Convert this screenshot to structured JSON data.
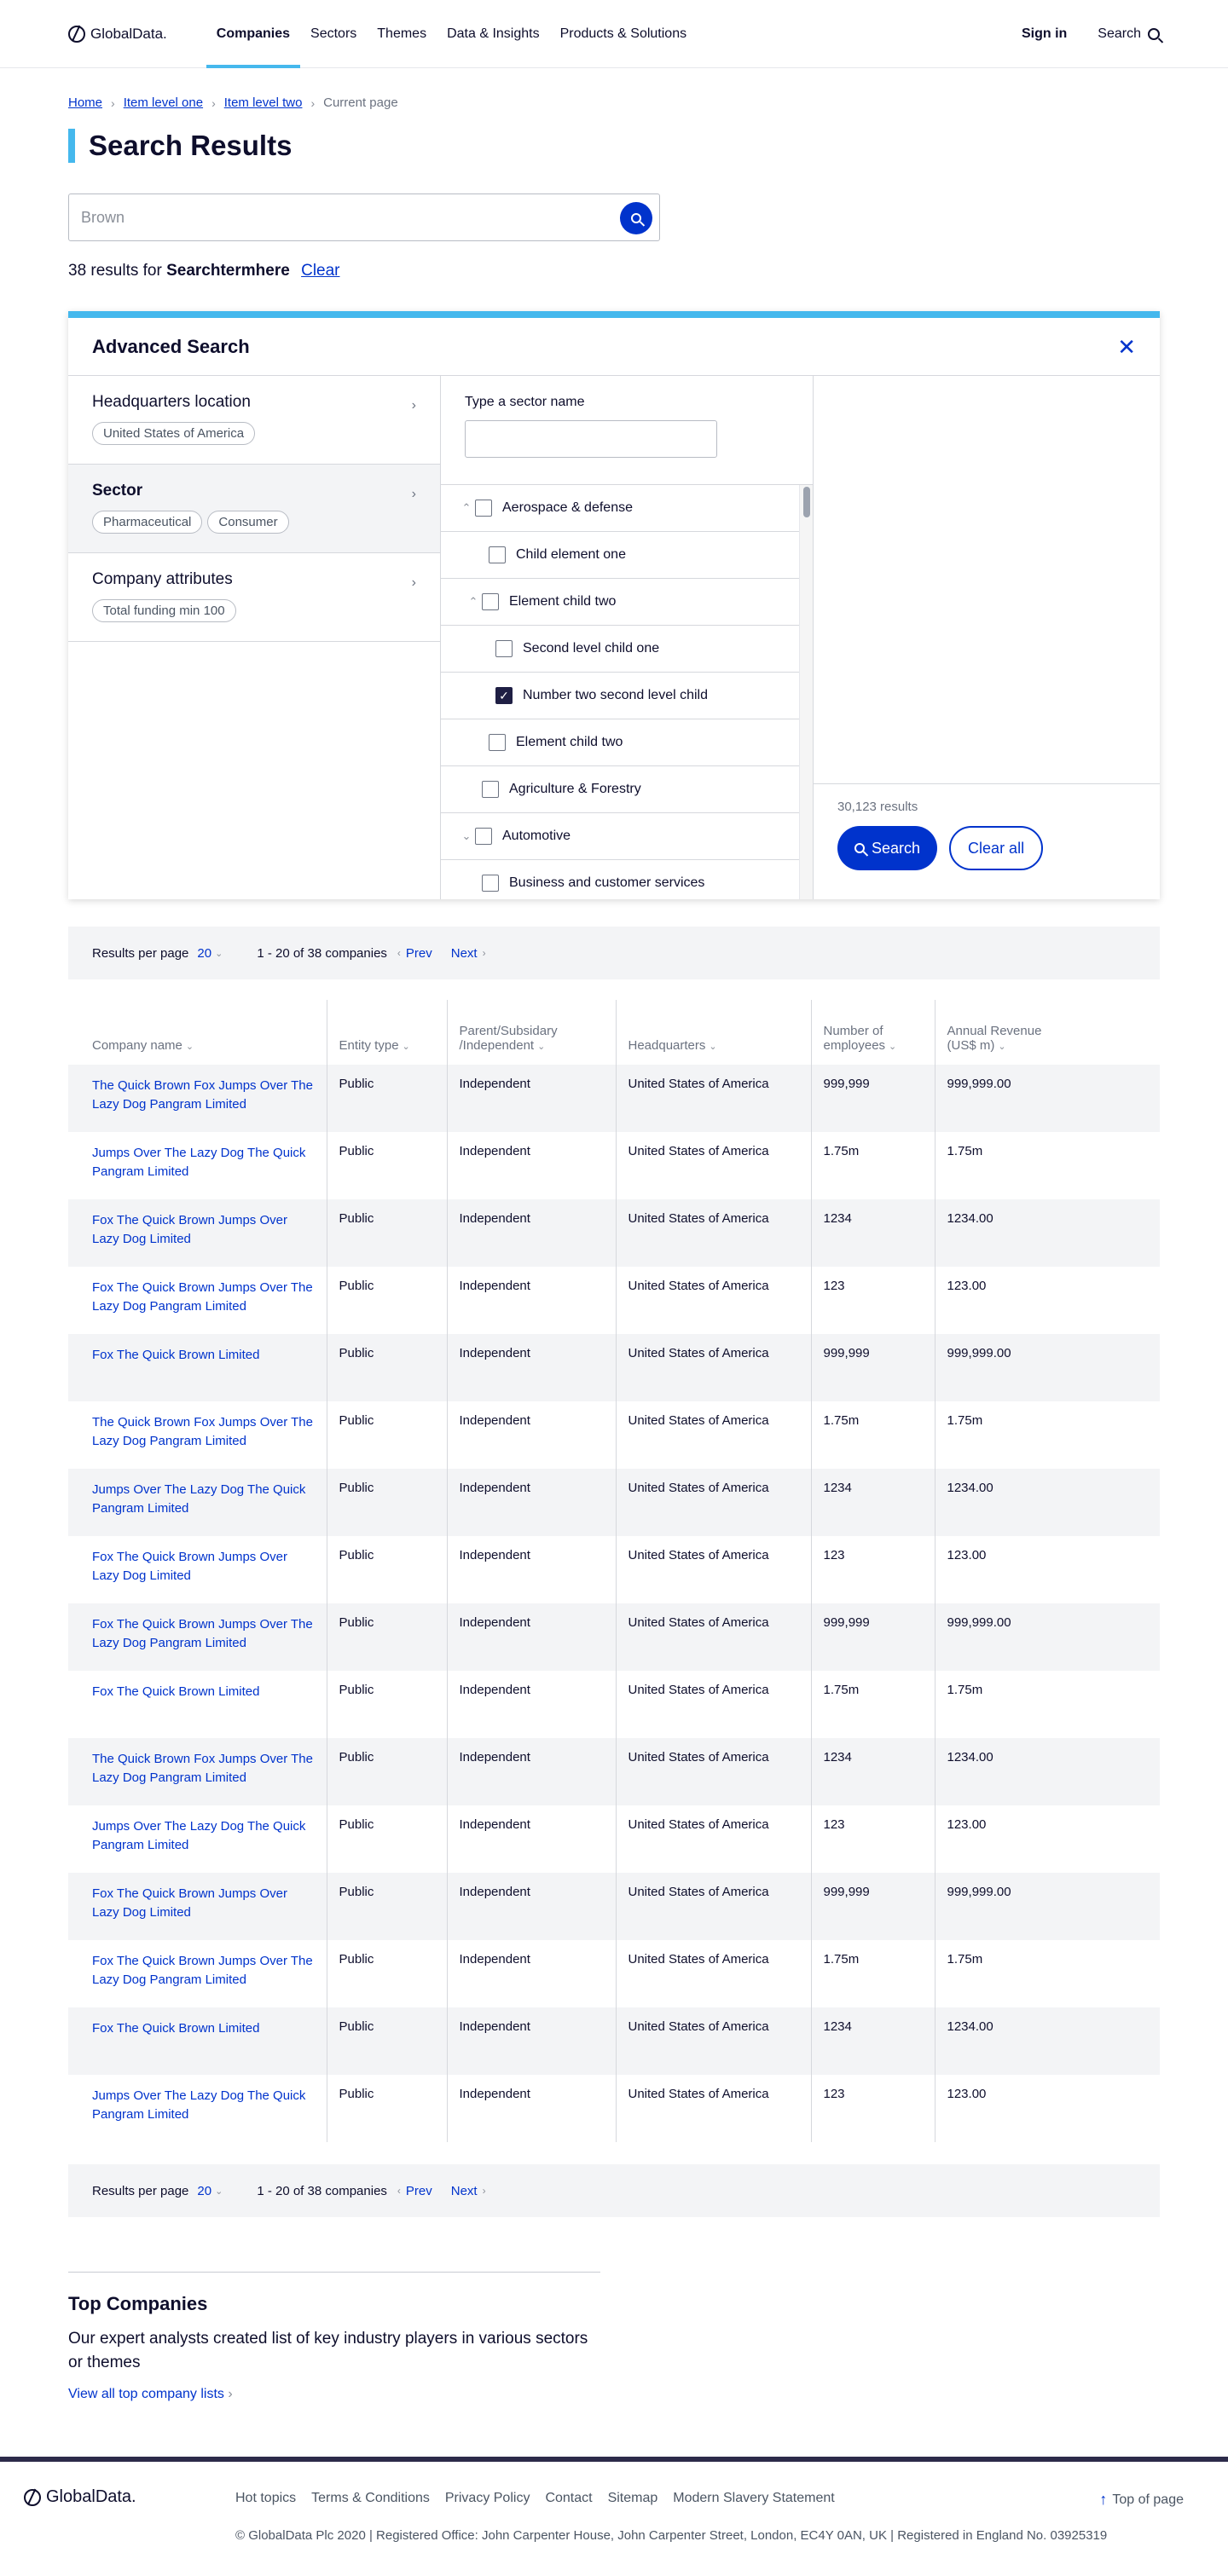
{
  "header": {
    "logo": "GlobalData.",
    "nav": [
      "Companies",
      "Sectors",
      "Themes",
      "Data & Insights",
      "Products & Solutions"
    ],
    "sign_in": "Sign in",
    "search": "Search"
  },
  "breadcrumb": {
    "home": "Home",
    "level1": "Item level one",
    "level2": "Item level two",
    "current": "Current page"
  },
  "page_title": "Search Results",
  "search": {
    "value": "Brown"
  },
  "results": {
    "count_prefix": "38 results for",
    "term": "Searchtermhere",
    "clear": "Clear"
  },
  "advanced": {
    "title": "Advanced Search",
    "filters": [
      {
        "title": "Headquarters location",
        "chips": [
          "United States of America"
        ]
      },
      {
        "title": "Sector",
        "chips": [
          "Pharmaceutical",
          "Consumer"
        ]
      },
      {
        "title": "Company attributes",
        "chips": [
          "Total funding min 100"
        ]
      }
    ],
    "sector_label": "Type a sector name",
    "tree": [
      {
        "label": "Aerospace & defense"
      },
      {
        "label": "Child element one"
      },
      {
        "label": "Element child two"
      },
      {
        "label": "Second level child one"
      },
      {
        "label": "Number two second level child"
      },
      {
        "label": "Element child two"
      },
      {
        "label": "Agriculture & Forestry"
      },
      {
        "label": "Automotive"
      },
      {
        "label": "Business and customer services"
      }
    ],
    "result_count": "30,123 results",
    "search_button": "Search",
    "clear_button": "Clear all"
  },
  "pager": {
    "rpp_label": "Results per page",
    "rpp_value": "20",
    "range": "1 - 20 of 38 companies",
    "prev": "Prev",
    "next": "Next"
  },
  "table": {
    "columns": [
      {
        "line1": "",
        "line2": "Company name"
      },
      {
        "line1": "",
        "line2": "Entity type"
      },
      {
        "line1": "Parent/Subsidary",
        "line2": "/Independent"
      },
      {
        "line1": "",
        "line2": "Headquarters"
      },
      {
        "line1": "Number of",
        "line2": "employees"
      },
      {
        "line1": "Annual Revenue",
        "line2": "(US$ m)"
      }
    ],
    "rows": [
      [
        "The Quick Brown Fox Jumps Over The Lazy Dog Pangram Limited",
        "Public",
        "Independent",
        "United States of America",
        "999,999",
        "999,999.00"
      ],
      [
        "Jumps Over The Lazy Dog The Quick Pangram Limited",
        "Public",
        "Independent",
        "United States of America",
        "1.75m",
        "1.75m"
      ],
      [
        "Fox The Quick Brown Jumps Over Lazy Dog Limited",
        "Public",
        "Independent",
        "United States of America",
        "1234",
        "1234.00"
      ],
      [
        "Fox The Quick Brown Jumps Over The Lazy Dog Pangram Limited",
        "Public",
        "Independent",
        "United States of America",
        "123",
        "123.00"
      ],
      [
        "Fox The Quick Brown Limited",
        "Public",
        "Independent",
        "United States of America",
        "999,999",
        "999,999.00"
      ],
      [
        "The Quick Brown Fox Jumps Over The Lazy Dog Pangram Limited",
        "Public",
        "Independent",
        "United States of America",
        "1.75m",
        "1.75m"
      ],
      [
        "Jumps Over The Lazy Dog The Quick Pangram Limited",
        "Public",
        "Independent",
        "United States of America",
        "1234",
        "1234.00"
      ],
      [
        "Fox The Quick Brown Jumps Over Lazy Dog Limited",
        "Public",
        "Independent",
        "United States of America",
        "123",
        "123.00"
      ],
      [
        "Fox The Quick Brown Jumps Over The Lazy Dog Pangram Limited",
        "Public",
        "Independent",
        "United States of America",
        "999,999",
        "999,999.00"
      ],
      [
        "Fox The Quick Brown Limited",
        "Public",
        "Independent",
        "United States of America",
        "1.75m",
        "1.75m"
      ],
      [
        "The Quick Brown Fox Jumps Over The Lazy Dog Pangram Limited",
        "Public",
        "Independent",
        "United States of America",
        "1234",
        "1234.00"
      ],
      [
        "Jumps Over The Lazy Dog The Quick Pangram Limited",
        "Public",
        "Independent",
        "United States of America",
        "123",
        "123.00"
      ],
      [
        "Fox The Quick Brown Jumps Over Lazy Dog Limited",
        "Public",
        "Independent",
        "United States of America",
        "999,999",
        "999,999.00"
      ],
      [
        "Fox The Quick Brown Jumps Over The Lazy Dog Pangram Limited",
        "Public",
        "Independent",
        "United States of America",
        "1.75m",
        "1.75m"
      ],
      [
        "Fox The Quick Brown Limited",
        "Public",
        "Independent",
        "United States of America",
        "1234",
        "1234.00"
      ],
      [
        "Jumps Over The Lazy Dog The Quick Pangram Limited",
        "Public",
        "Independent",
        "United States of America",
        "123",
        "123.00"
      ]
    ]
  },
  "top_companies": {
    "title": "Top Companies",
    "text": "Our expert analysts created list of key industry players in various sectors or themes",
    "link": "View all top company lists"
  },
  "footer": {
    "logo": "GlobalData.",
    "links": [
      "Hot topics",
      "Terms & Conditions",
      "Privacy Policy",
      "Contact",
      "Sitemap",
      "Modern Slavery Statement"
    ],
    "top": "Top of page",
    "copyright": "© GlobalData Plc 2020 | Registered Office: John Carpenter House, John Carpenter Street, London, EC4Y 0AN, UK | Registered in England No. 03925319"
  },
  "colors": {
    "accent": "#45b8ed",
    "primary": "#0033cc",
    "text": "#0e0e2c",
    "footer_bar": "#2d2b4a"
  }
}
